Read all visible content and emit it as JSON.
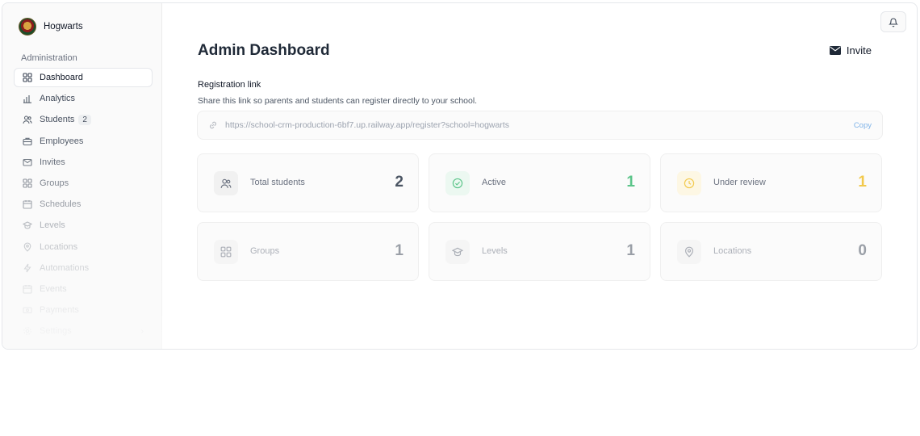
{
  "brand": {
    "name": "Hogwarts"
  },
  "sidebar": {
    "heading": "Administration",
    "items": [
      {
        "label": "Dashboard",
        "icon": "grid-icon",
        "active": true
      },
      {
        "label": "Analytics",
        "icon": "bar-chart-icon"
      },
      {
        "label": "Students",
        "icon": "users-icon",
        "badge": "2"
      },
      {
        "label": "Employees",
        "icon": "briefcase-icon"
      },
      {
        "label": "Invites",
        "icon": "mail-icon"
      },
      {
        "label": "Groups",
        "icon": "grid-icon"
      },
      {
        "label": "Schedules",
        "icon": "calendar-icon"
      },
      {
        "label": "Levels",
        "icon": "graduation-cap-icon"
      },
      {
        "label": "Locations",
        "icon": "map-pin-icon"
      },
      {
        "label": "Automations",
        "icon": "lightning-icon"
      },
      {
        "label": "Events",
        "icon": "calendar-icon"
      },
      {
        "label": "Payments",
        "icon": "banknote-icon"
      },
      {
        "label": "Settings",
        "icon": "gear-icon"
      }
    ]
  },
  "header": {
    "title": "Admin Dashboard",
    "invite_label": "Invite"
  },
  "registration": {
    "label": "Registration link",
    "description": "Share this link so parents and students can register directly to your school.",
    "url": "https://school-crm-production-6bf7.up.railway.app/register?school=hogwarts",
    "copy_label": "Copy"
  },
  "stats": [
    {
      "label": "Total students",
      "value": "2",
      "icon": "users-icon",
      "color": "#4b5563"
    },
    {
      "label": "Active",
      "value": "1",
      "icon": "check-circle-icon",
      "color": "#5cc58a"
    },
    {
      "label": "Under review",
      "value": "1",
      "icon": "clock-icon",
      "color": "#f2c94c"
    },
    {
      "label": "Groups",
      "value": "1",
      "icon": "grid-icon",
      "color": "#4b5563"
    },
    {
      "label": "Levels",
      "value": "1",
      "icon": "graduation-cap-icon",
      "color": "#4b5563"
    },
    {
      "label": "Locations",
      "value": "0",
      "icon": "map-pin-icon",
      "color": "#4b5563"
    }
  ]
}
